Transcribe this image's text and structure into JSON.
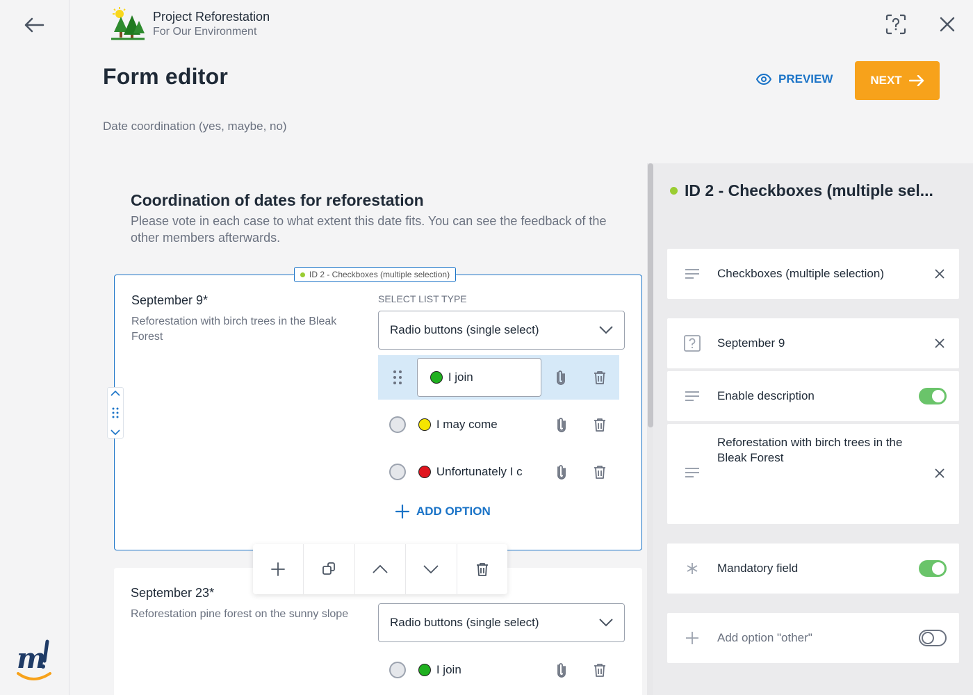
{
  "colors": {
    "accent": "#1a73c7",
    "next": "#f7a21b",
    "green": "#1fb01f",
    "yellow": "#f5e500",
    "red": "#e0141e",
    "active_dot": "#9acd32",
    "toggle_on": "#6ac46a"
  },
  "rail": {
    "back_icon": "arrow-left-icon",
    "brand_icon": "brand-m-logo"
  },
  "project": {
    "name": "Project Reforestation",
    "subtitle": "For Our Environment"
  },
  "header": {
    "help_icon": "help-scan-icon",
    "close_icon": "close-icon",
    "title": "Form editor",
    "preview_label": "PREVIEW",
    "next_label": "NEXT"
  },
  "form": {
    "subtitle": "Date coordination (yes, maybe, no)",
    "title": "Coordination of dates for reforestation",
    "description": "Please vote in each case to what extent this date fits. You can see the feedback of the other members afterwards."
  },
  "question1": {
    "tag": "ID 2 - Checkboxes (multiple selection)",
    "title": "September 9*",
    "description": "Reforestation with birch trees in the Bleak Forest",
    "list_type_label": "SELECT LIST TYPE",
    "list_type_value": "Radio buttons (single select)",
    "options": [
      {
        "label": "I join",
        "color": "green"
      },
      {
        "label": "I may come",
        "color": "yellow"
      },
      {
        "label": "Unfortunately I c",
        "color": "red"
      }
    ],
    "add_option_label": "ADD OPTION"
  },
  "toolbar": {
    "icons": [
      "add-icon",
      "duplicate-icon",
      "move-up-icon",
      "move-down-icon",
      "delete-icon"
    ]
  },
  "question2": {
    "title": "September 23*",
    "description": "Reforestation pine forest on the sunny slope",
    "list_type_value": "Radio buttons (single select)",
    "first_option": "I join"
  },
  "panel": {
    "title": "ID 2 - Checkboxes (multiple sel...",
    "type_label": "Checkboxes (multiple selection)",
    "question_label": "September 9",
    "enable_description_label": "Enable description",
    "description_text": "Reforestation with birch trees in the Bleak Forest",
    "mandatory_label": "Mandatory field",
    "add_other_label": "Add option \"other\"",
    "enable_description_on": true,
    "mandatory_on": true,
    "add_other_on": false
  }
}
